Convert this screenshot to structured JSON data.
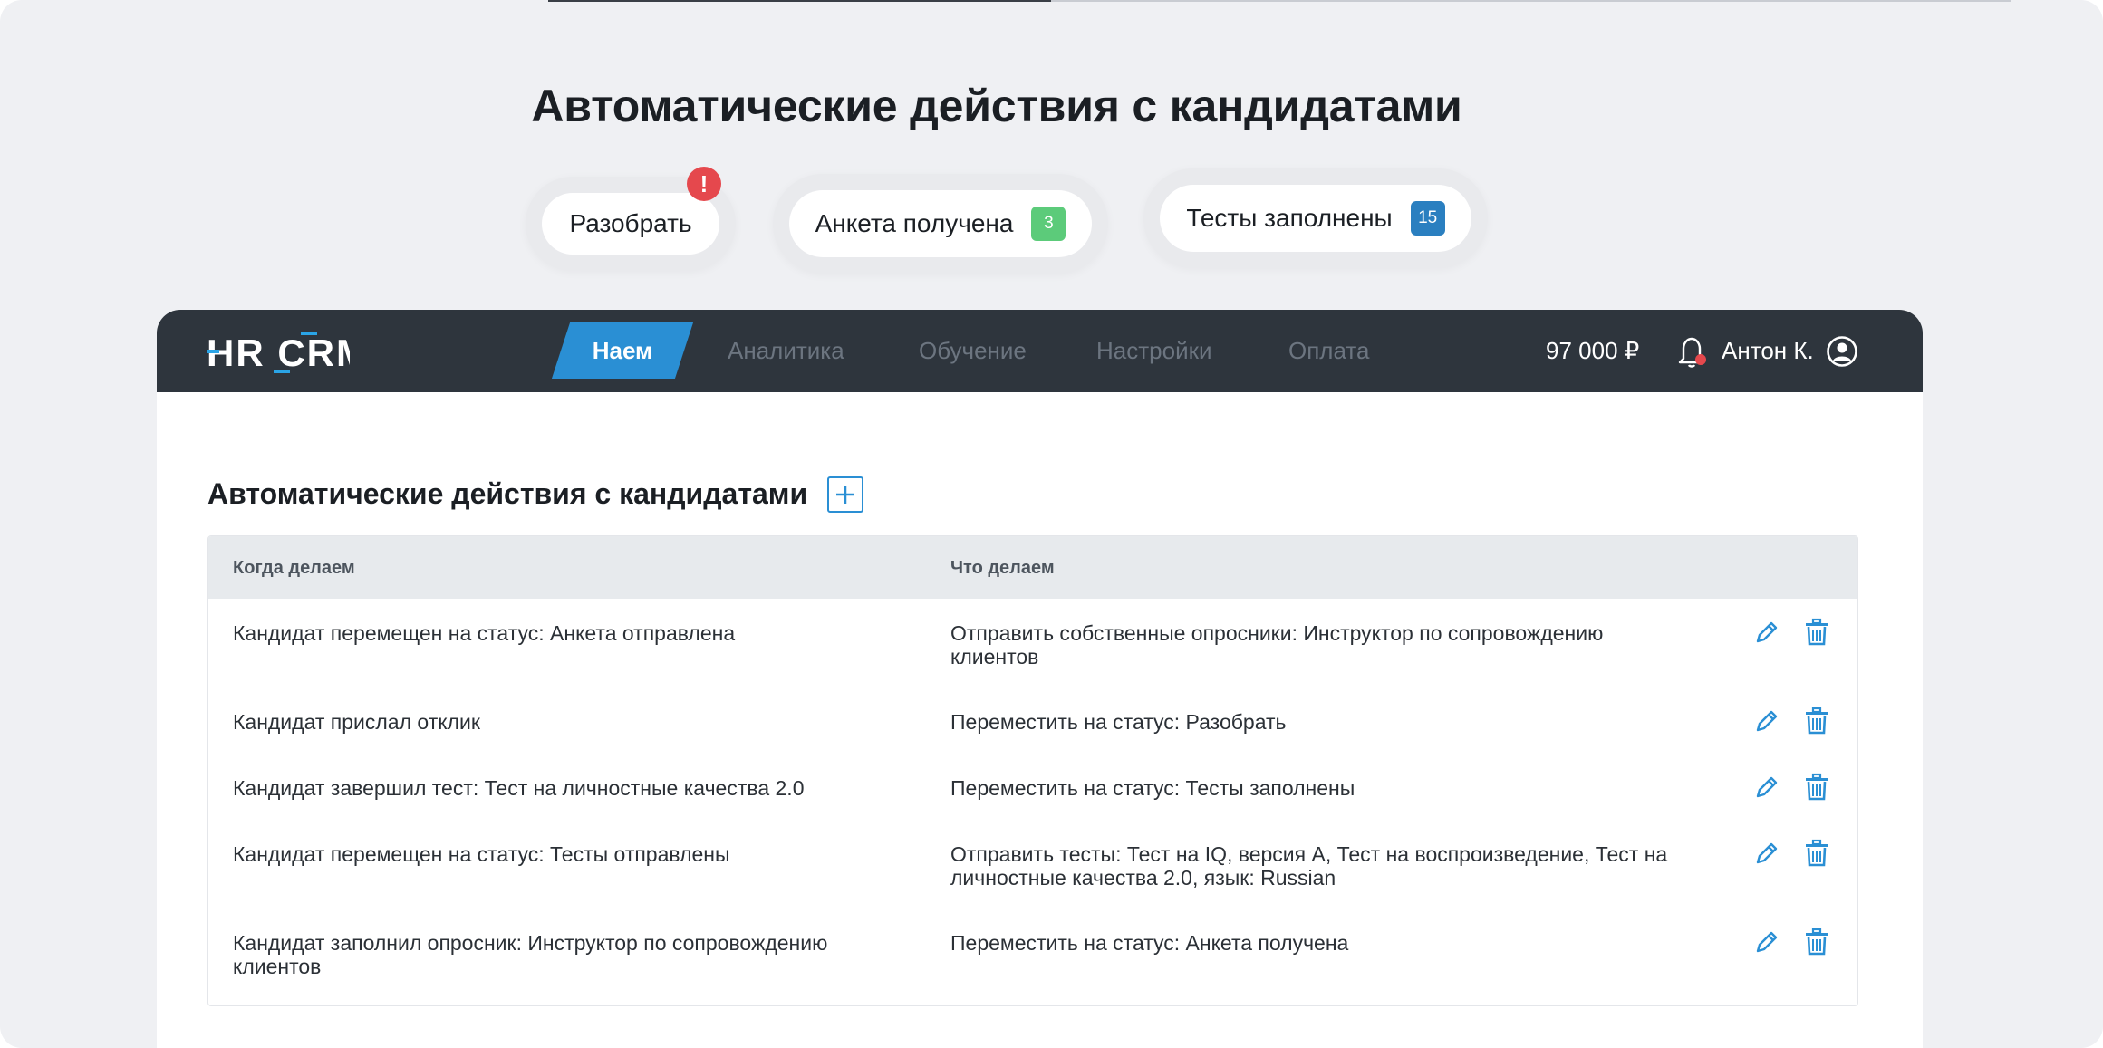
{
  "hero": {
    "title": "Автоматические действия с кандидатами"
  },
  "status_pills": [
    {
      "label": "Разобрать",
      "alert": "!"
    },
    {
      "label": "Анкета получена",
      "count": "3",
      "badge_color": "#5ccb7a"
    },
    {
      "label": "Тесты заполнены",
      "count": "15",
      "badge_color": "#2a7fc0"
    }
  ],
  "nav": {
    "logo": "HR CRM",
    "items": [
      "Наем",
      "Аналитика",
      "Обучение",
      "Настройки",
      "Оплата"
    ],
    "active_index": 0,
    "balance": "97 000 ₽",
    "user_name": "Антон К."
  },
  "section": {
    "title": "Автоматические действия с кандидатами"
  },
  "table": {
    "headers": [
      "Когда делаем",
      "Что делаем"
    ],
    "rows": [
      {
        "when": "Кандидат перемещен на статус: Анкета отправлена",
        "what": "Отправить собственные опросники: Инструктор по сопровождению клиентов"
      },
      {
        "when": "Кандидат прислал отклик",
        "what": "Переместить на статус: Разобрать"
      },
      {
        "when": "Кандидат завершил тест: Тест на личностные качества 2.0",
        "what": "Переместить на статус: Тесты заполнены"
      },
      {
        "when": "Кандидат перемещен на статус: Тесты отправлены",
        "what": "Отправить тесты: Тест на IQ, версия А, Тест на воспроизведение, Тест на личностные качества 2.0, язык: Russian"
      },
      {
        "when": "Кандидат заполнил опросник: Инструктор по сопровождению клиентов",
        "what": "Переместить на статус: Анкета получена"
      }
    ]
  },
  "colors": {
    "accent": "#2a8fd4",
    "nav_bg": "#2e353d",
    "alert": "#e5484d"
  }
}
